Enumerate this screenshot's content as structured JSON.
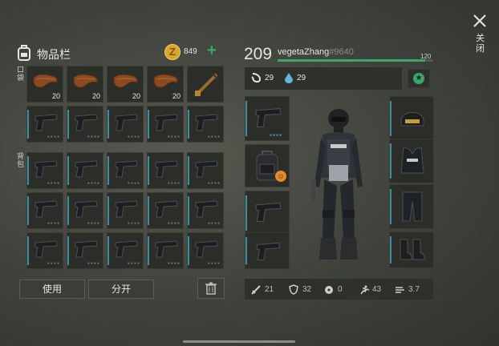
{
  "inventory": {
    "title": "物品栏",
    "coins": "849",
    "section_pocket": "口袋",
    "section_backpack": "背包",
    "pocket_row1": [
      {
        "item": "leather",
        "qty": "20"
      },
      {
        "item": "leather",
        "qty": "20"
      },
      {
        "item": "leather",
        "qty": "20"
      },
      {
        "item": "leather",
        "qty": "20"
      },
      {
        "item": "crossbow",
        "qty": ""
      }
    ],
    "use_button": "使用",
    "split_button": "分开"
  },
  "character": {
    "level": "209",
    "name": "vegetaZhang",
    "tag": "#9640",
    "xp_value": "120",
    "xp_fraction": 0.95,
    "food": "29",
    "water": "29"
  },
  "stats": [
    {
      "icon": "sword-icon",
      "value": "21"
    },
    {
      "icon": "shield-icon",
      "value": "32"
    },
    {
      "icon": "radiation-icon",
      "value": "0"
    },
    {
      "icon": "run-icon",
      "value": "43"
    },
    {
      "icon": "wind-icon",
      "value": "3.7"
    }
  ],
  "close_label": "关闭",
  "colors": {
    "accent": "#3aa86a",
    "slot_bar": "#3a8e9e",
    "coin": "#d9a52a"
  }
}
